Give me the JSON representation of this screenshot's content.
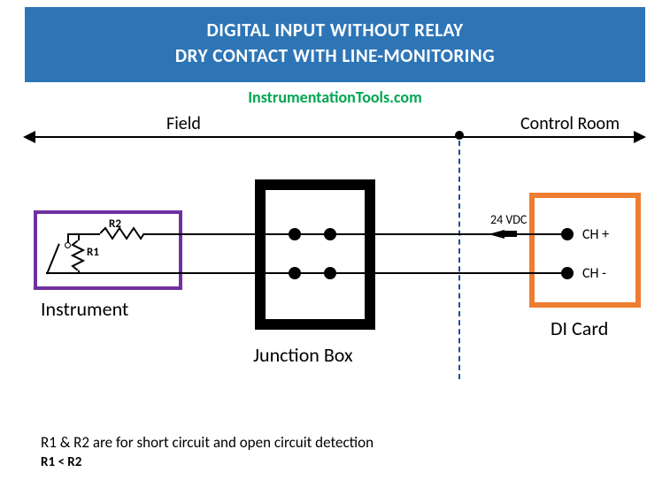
{
  "title_line1": "DIGITAL INPUT WITHOUT RELAY",
  "title_line2": "DRY CONTACT WITH LINE-MONITORING",
  "source": "InstrumentationTools.com",
  "regions": {
    "field": "Field",
    "control_room": "Control Room"
  },
  "instrument": {
    "label": "Instrument",
    "r1": "R1",
    "r2": "R2"
  },
  "junction": {
    "label": "Junction Box"
  },
  "dicard": {
    "label": "DI Card",
    "ch_plus": "CH +",
    "ch_minus": "CH -",
    "voltage": "24 VDC"
  },
  "notes": {
    "desc": "R1 & R2 are for short circuit and open circuit detection",
    "relation": "R1 < R2"
  }
}
